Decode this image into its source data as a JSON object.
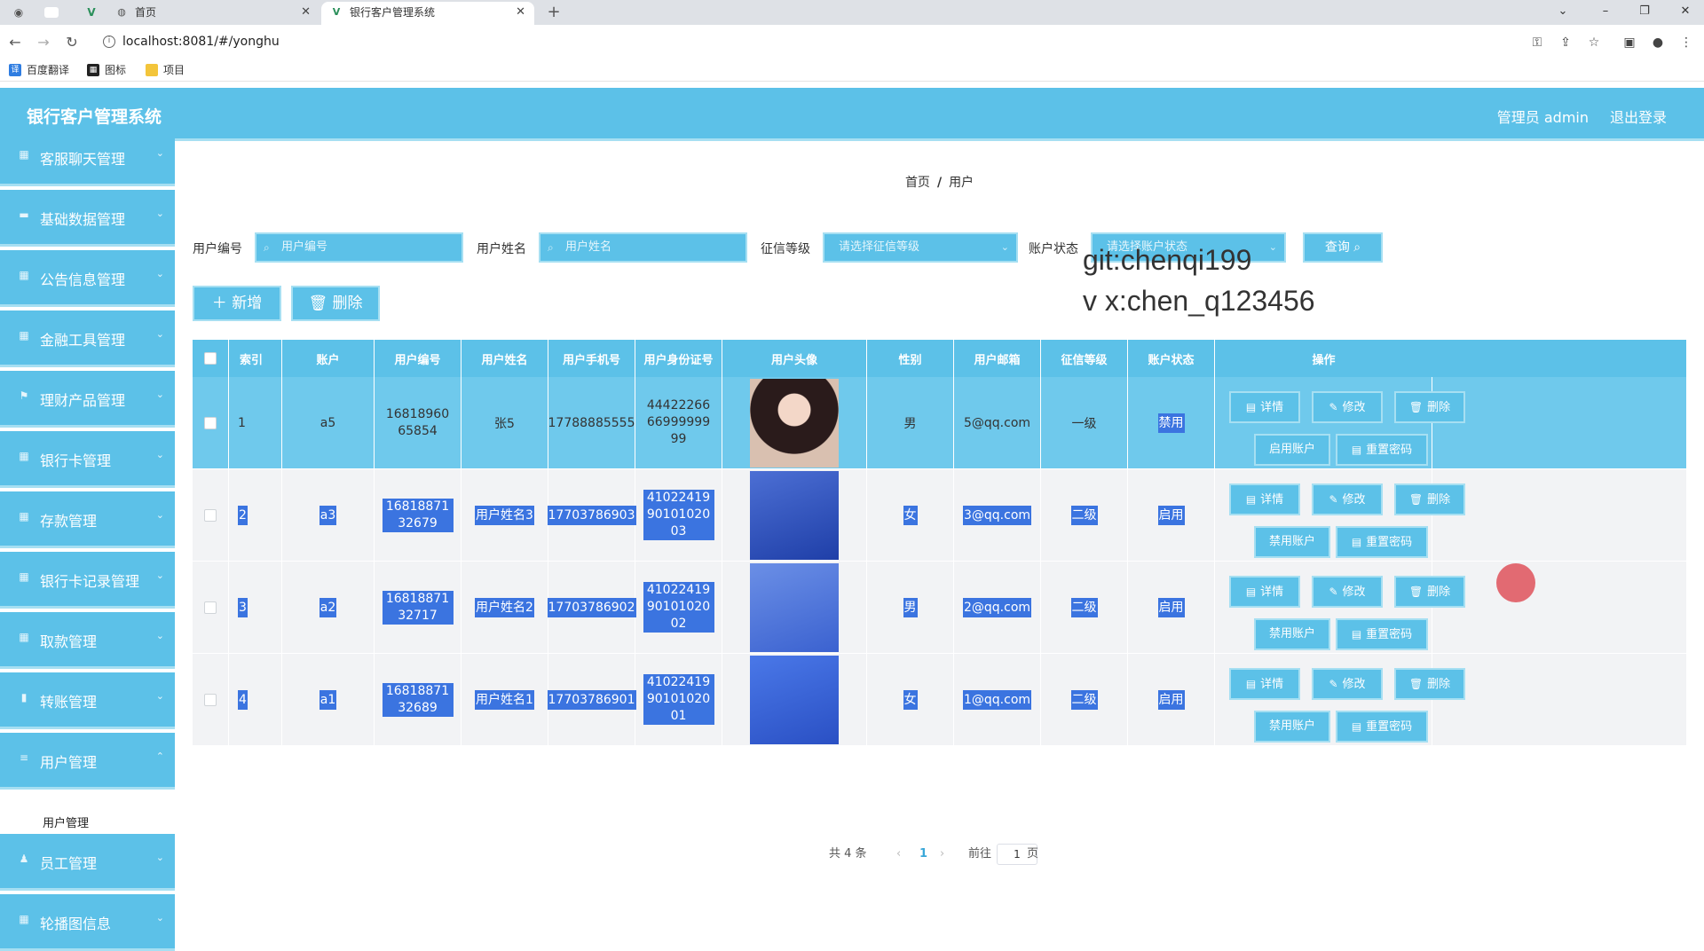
{
  "browser": {
    "tabs": [
      {
        "title": "首页",
        "active": false
      },
      {
        "title": "银行客户管理系统",
        "active": true
      }
    ],
    "url": "localhost:8081/#/yonghu",
    "bookmarks": [
      "百度翻译",
      "图标",
      "项目"
    ]
  },
  "header": {
    "title": "银行客户管理系统",
    "admin": "管理员 admin",
    "logout": "退出登录"
  },
  "sidebar": {
    "items": [
      {
        "label": "客服聊天管理",
        "icon": "grid-icon"
      },
      {
        "label": "基础数据管理",
        "icon": "monitor-icon"
      },
      {
        "label": "公告信息管理",
        "icon": "grid-icon"
      },
      {
        "label": "金融工具管理",
        "icon": "grid-icon"
      },
      {
        "label": "理财产品管理",
        "icon": "flag-icon"
      },
      {
        "label": "银行卡管理",
        "icon": "grid-icon"
      },
      {
        "label": "存款管理",
        "icon": "grid-icon"
      },
      {
        "label": "银行卡记录管理",
        "icon": "grid-icon"
      },
      {
        "label": "取款管理",
        "icon": "grid-icon"
      },
      {
        "label": "转账管理",
        "icon": "lock-icon"
      },
      {
        "label": "用户管理",
        "icon": "menu-icon"
      },
      {
        "label": "员工管理",
        "icon": "user-icon"
      },
      {
        "label": "轮播图信息",
        "icon": "grid-icon"
      }
    ],
    "submenu": "用户管理"
  },
  "breadcrumb": {
    "home": "首页",
    "current": "用户"
  },
  "search": {
    "fields": [
      {
        "label": "用户编号",
        "placeholder": "用户编号"
      },
      {
        "label": "用户姓名",
        "placeholder": "用户姓名"
      },
      {
        "label": "征信等级",
        "placeholder": "请选择征信等级"
      },
      {
        "label": "账户状态",
        "placeholder": "请选择账户状态"
      }
    ],
    "query_label": "查询"
  },
  "watermark": {
    "line1": "git:chenqi199",
    "line2": "v x:chen_q123456"
  },
  "actions": {
    "add_label": "新增",
    "delete_label": "删除"
  },
  "table": {
    "columns": [
      "",
      "索引",
      "账户",
      "用户编号",
      "用户姓名",
      "用户手机号",
      "用户身份证号",
      "用户头像",
      "性别",
      "用户邮箱",
      "征信等级",
      "账户状态",
      "操作"
    ],
    "rows": [
      {
        "index": "1",
        "account": "a5",
        "user_no": "1681896065854",
        "name": "张5",
        "phone": "17788885555",
        "id_card": "444222666699999999",
        "gender": "男",
        "email": "5@qq.com",
        "credit": "一级",
        "status": "禁用",
        "toggle_label": "启用账户"
      },
      {
        "index": "2",
        "account": "a3",
        "user_no": "1681887132679",
        "name": "用户姓名3",
        "phone": "17703786903",
        "id_card": "410224199010102003",
        "gender": "女",
        "email": "3@qq.com",
        "credit": "二级",
        "status": "启用",
        "toggle_label": "禁用账户"
      },
      {
        "index": "3",
        "account": "a2",
        "user_no": "1681887132717",
        "name": "用户姓名2",
        "phone": "17703786902",
        "id_card": "410224199010102002",
        "gender": "男",
        "email": "2@qq.com",
        "credit": "二级",
        "status": "启用",
        "toggle_label": "禁用账户"
      },
      {
        "index": "4",
        "account": "a1",
        "user_no": "1681887132689",
        "name": "用户姓名1",
        "phone": "17703786901",
        "id_card": "410224199010102001",
        "gender": "女",
        "email": "1@qq.com",
        "credit": "二级",
        "status": "启用",
        "toggle_label": "禁用账户"
      }
    ],
    "op_labels": {
      "detail": "详情",
      "edit": "修改",
      "delete": "删除",
      "reset": "重置密码"
    }
  },
  "pagination": {
    "total": "共 4 条",
    "page": "1",
    "goto": "前往",
    "page_input": "1",
    "page_suffix": "页"
  },
  "colors": {
    "primary": "#5cc1e8",
    "border": "#a6dff2",
    "selection": "#3b74e0"
  }
}
